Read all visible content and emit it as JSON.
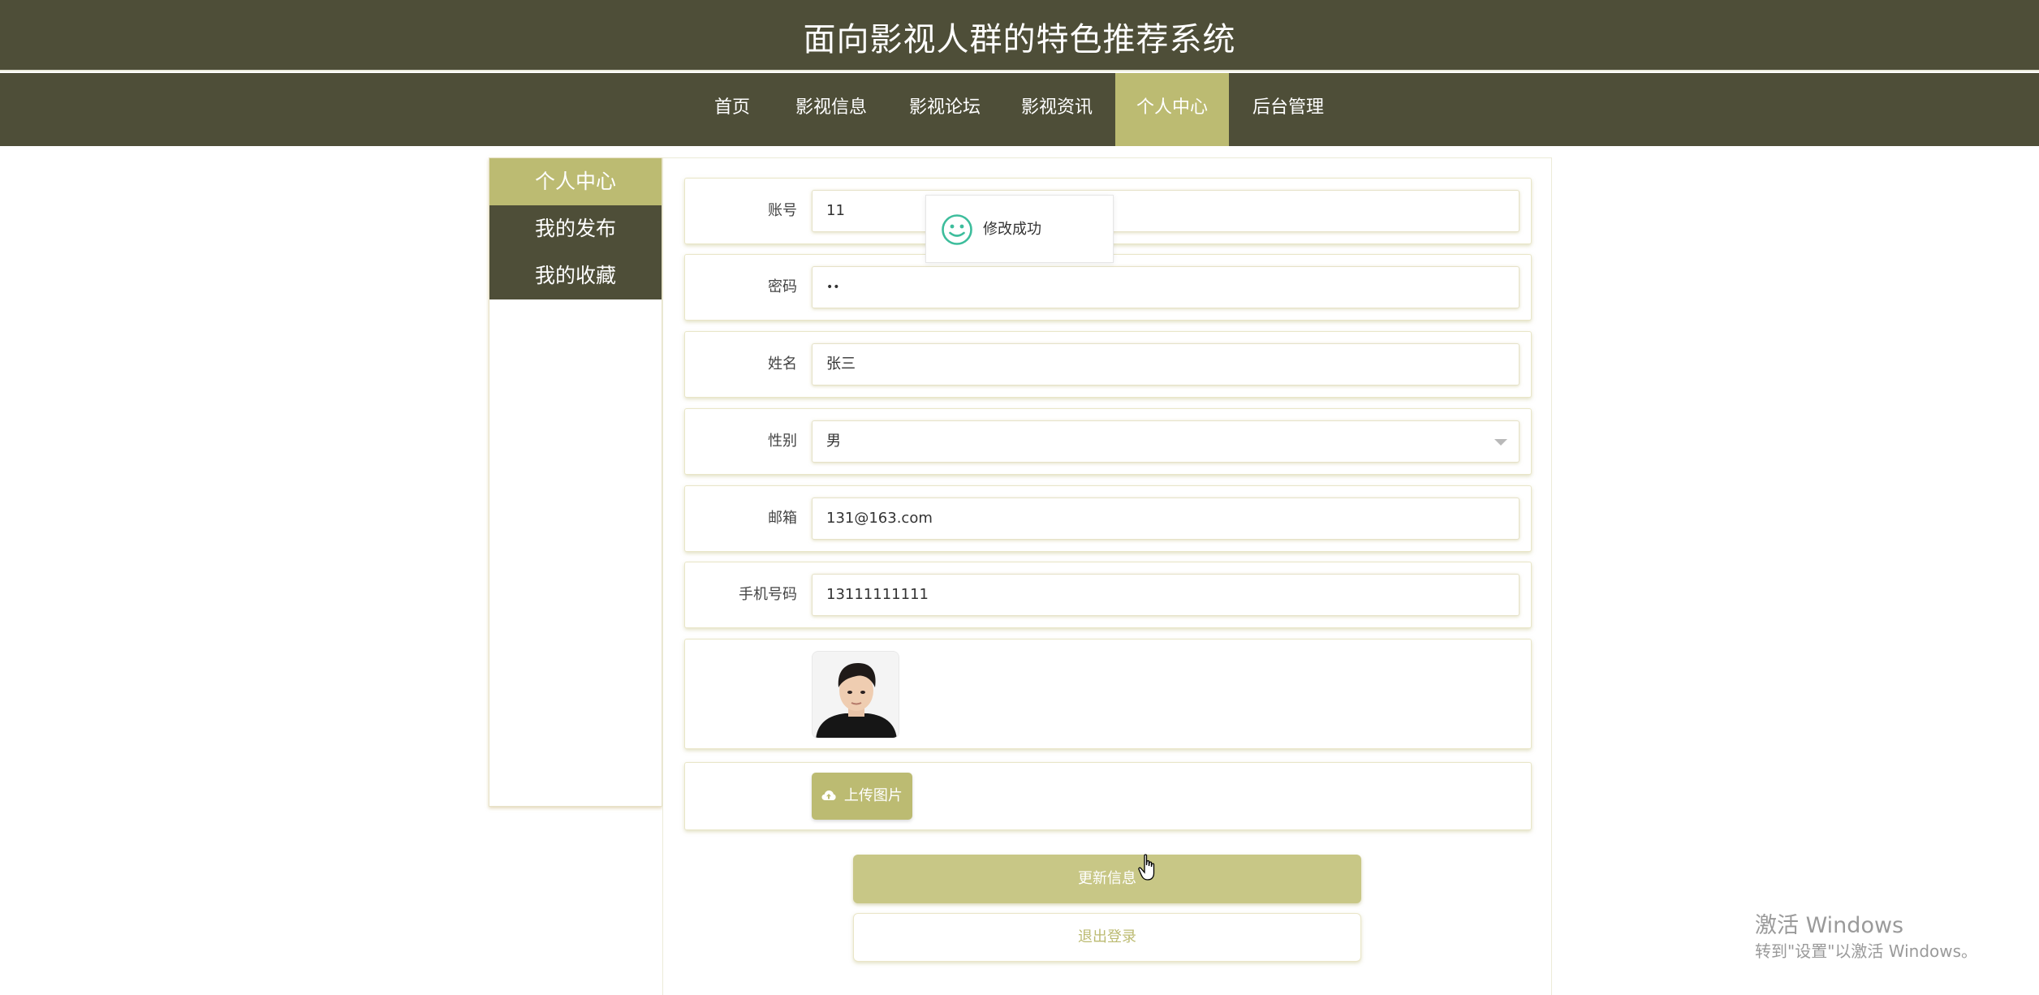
{
  "header": {
    "title": "面向影视人群的特色推荐系统"
  },
  "nav": {
    "items": [
      {
        "label": "首页"
      },
      {
        "label": "影视信息"
      },
      {
        "label": "影视论坛"
      },
      {
        "label": "影视资讯"
      },
      {
        "label": "个人中心",
        "active": true
      },
      {
        "label": "后台管理"
      }
    ]
  },
  "sidebar": {
    "items": [
      {
        "label": "个人中心",
        "active": true
      },
      {
        "label": "我的发布"
      },
      {
        "label": "我的收藏"
      }
    ]
  },
  "form": {
    "account": {
      "label": "账号",
      "value": "11"
    },
    "password": {
      "label": "密码",
      "value": "••"
    },
    "name": {
      "label": "姓名",
      "value": "张三"
    },
    "gender": {
      "label": "性别",
      "value": "男"
    },
    "email": {
      "label": "邮箱",
      "value": "131@163.com"
    },
    "phone": {
      "label": "手机号码",
      "value": "13111111111"
    },
    "upload_label": "上传图片",
    "update_label": "更新信息",
    "logout_label": "退出登录"
  },
  "toast": {
    "message": "修改成功",
    "icon": "smile-icon"
  },
  "watermark": {
    "title": "激活 Windows",
    "subtitle": "转到\"设置\"以激活 Windows。"
  },
  "colors": {
    "dark": "#4e4e38",
    "accent": "#bcbb72",
    "success": "#3dbd9c"
  }
}
